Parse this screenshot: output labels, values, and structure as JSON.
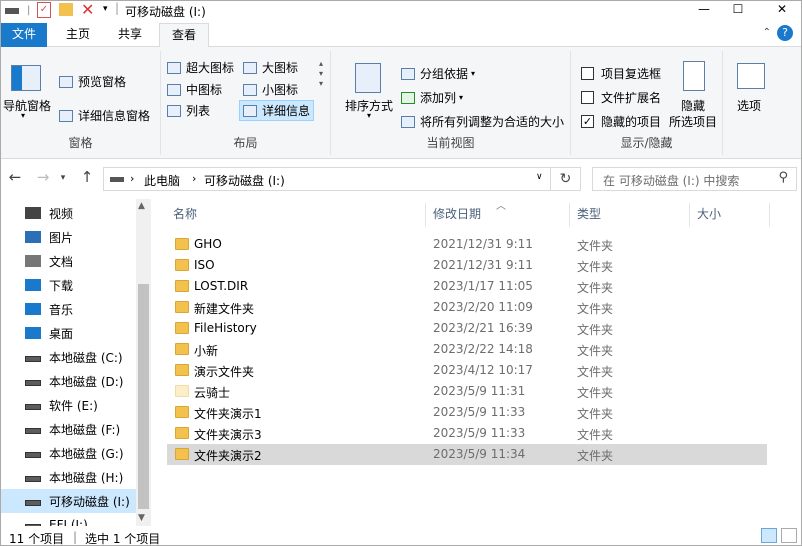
{
  "window": {
    "title": "可移动磁盘 (I:)",
    "minimize": "—",
    "maximize": "☐",
    "close": "✕"
  },
  "ribbon": {
    "tabs": {
      "file": "文件",
      "home": "主页",
      "share": "共享",
      "view": "查看"
    },
    "pane": {
      "nav_pane": "导航窗格",
      "preview": "预览窗格",
      "details": "详细信息窗格",
      "label": "窗格"
    },
    "layout": {
      "extra_large": "超大图标",
      "large": "大图标",
      "medium": "中图标",
      "small": "小图标",
      "list": "列表",
      "details": "详细信息",
      "label": "布局"
    },
    "current_view": {
      "sort_by": "排序方式",
      "group_by": "分组依据",
      "add_columns": "添加列",
      "size_all_columns": "将所有列调整为合适的大小",
      "label": "当前视图"
    },
    "show_hide": {
      "item_checkboxes": "项目复选框",
      "file_ext": "文件扩展名",
      "hidden_items": "隐藏的项目",
      "hide_selected_1": "隐藏",
      "hide_selected_2": "所选项目",
      "options": "选项",
      "label": "显示/隐藏",
      "item_checkboxes_checked": false,
      "file_ext_checked": false,
      "hidden_items_checked": true
    }
  },
  "address": {
    "crumb1": "此电脑",
    "crumb2": "可移动磁盘 (I:)",
    "search_placeholder": "在 可移动磁盘 (I:) 中搜索"
  },
  "nav_pane": [
    {
      "label": "视频",
      "icon": "video-icon"
    },
    {
      "label": "图片",
      "icon": "pictures-icon"
    },
    {
      "label": "文档",
      "icon": "documents-icon"
    },
    {
      "label": "下载",
      "icon": "download-icon"
    },
    {
      "label": "音乐",
      "icon": "music-icon"
    },
    {
      "label": "桌面",
      "icon": "desktop-icon"
    },
    {
      "label": "本地磁盘 (C:)",
      "icon": "drive-icon"
    },
    {
      "label": "本地磁盘 (D:)",
      "icon": "drive-icon"
    },
    {
      "label": "软件 (E:)",
      "icon": "drive-icon"
    },
    {
      "label": "本地磁盘 (F:)",
      "icon": "drive-icon"
    },
    {
      "label": "本地磁盘 (G:)",
      "icon": "drive-icon"
    },
    {
      "label": "本地磁盘 (H:)",
      "icon": "drive-icon"
    },
    {
      "label": "可移动磁盘 (I:)",
      "icon": "drive-icon",
      "selected": true
    },
    {
      "label": "EFI (J:)",
      "icon": "drive-icon"
    }
  ],
  "columns": {
    "name": "名称",
    "modified": "修改日期",
    "type": "类型",
    "size": "大小"
  },
  "files": [
    {
      "name": "GHO",
      "modified": "2021/12/31 9:11",
      "type": "文件夹"
    },
    {
      "name": "ISO",
      "modified": "2021/12/31 9:11",
      "type": "文件夹"
    },
    {
      "name": "LOST.DIR",
      "modified": "2023/1/17 11:05",
      "type": "文件夹"
    },
    {
      "name": "新建文件夹",
      "modified": "2023/2/20 11:09",
      "type": "文件夹"
    },
    {
      "name": "FileHistory",
      "modified": "2023/2/21 16:39",
      "type": "文件夹"
    },
    {
      "name": "小新",
      "modified": "2023/2/22 14:18",
      "type": "文件夹"
    },
    {
      "name": "演示文件夹",
      "modified": "2023/4/12 10:17",
      "type": "文件夹"
    },
    {
      "name": "云骑士",
      "modified": "2023/5/9 11:31",
      "type": "文件夹",
      "hidden": true
    },
    {
      "name": "文件夹演示1",
      "modified": "2023/5/9 11:33",
      "type": "文件夹"
    },
    {
      "name": "文件夹演示3",
      "modified": "2023/5/9 11:33",
      "type": "文件夹"
    },
    {
      "name": "文件夹演示2",
      "modified": "2023/5/9 11:34",
      "type": "文件夹",
      "selected": true
    }
  ],
  "status": {
    "count": "11 个项目",
    "selection": "选中 1 个项目"
  }
}
